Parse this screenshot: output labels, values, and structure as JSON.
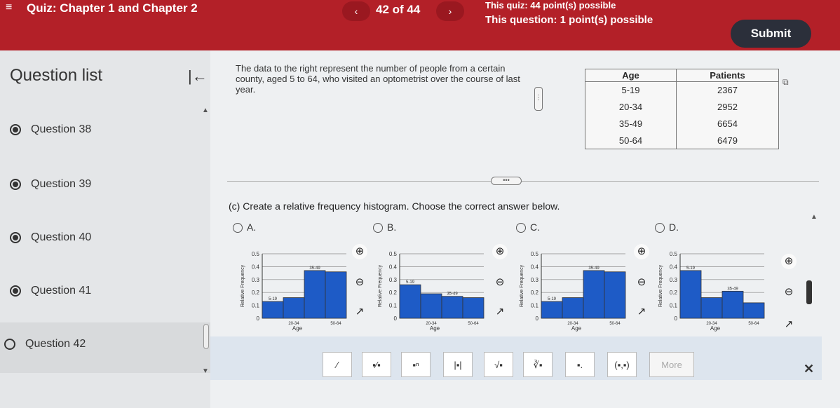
{
  "header": {
    "menu_icon": "≡",
    "quiz_title": "Quiz: Chapter 1 and Chapter 2",
    "prev_icon": "‹",
    "question_counter": "42 of 44",
    "next_icon": "›",
    "quiz_points": "This quiz: 44 point(s) possible",
    "question_points": "This question: 1 point(s) possible",
    "submit_label": "Submit"
  },
  "sidebar": {
    "title": "Question list",
    "collapse_icon": "|←",
    "items": [
      {
        "label": "Question 38"
      },
      {
        "label": "Question 39"
      },
      {
        "label": "Question 40"
      },
      {
        "label": "Question 41"
      },
      {
        "label": "Question 42"
      }
    ]
  },
  "main": {
    "intro": "The data to the right represent the number of people from a certain county, aged 5 to 64, who visited an optometrist over the course of last year.",
    "table": {
      "headers": [
        "Age",
        "Patients"
      ],
      "rows": [
        [
          "5-19",
          "2367"
        ],
        [
          "20-34",
          "2952"
        ],
        [
          "35-49",
          "6654"
        ],
        [
          "50-64",
          "6479"
        ]
      ]
    },
    "prompt": "(c) Create a relative frequency histogram. Choose the correct answer below.",
    "options": [
      {
        "label": "A."
      },
      {
        "label": "B."
      },
      {
        "label": "C."
      },
      {
        "label": "D."
      }
    ]
  },
  "chart_data": [
    {
      "type": "bar",
      "option": "A",
      "categories": [
        "5-19",
        "20-34",
        "35-49",
        "50-64"
      ],
      "values": [
        0.13,
        0.16,
        0.37,
        0.36
      ],
      "ylim": [
        0,
        0.5
      ],
      "yticks": [
        "0",
        "0.1",
        "0.2",
        "0.3",
        "0.4",
        "0.5"
      ],
      "ylabel": "Relative Frequency",
      "xlabel": "Age",
      "bar_labels": [
        "5-19",
        "",
        "35-49",
        ""
      ],
      "xtick_labels": [
        "20-34",
        "50-64"
      ]
    },
    {
      "type": "bar",
      "option": "B",
      "categories": [
        "5-19",
        "20-34",
        "35-49",
        "50-64"
      ],
      "values": [
        0.26,
        0.19,
        0.17,
        0.16
      ],
      "ylim": [
        0,
        0.5
      ],
      "yticks": [
        "0",
        "0.1",
        "0.2",
        "0.3",
        "0.4",
        "0.5"
      ],
      "ylabel": "Relative Frequency",
      "xlabel": "Age",
      "bar_labels": [
        "5-19",
        "",
        "35-49",
        ""
      ],
      "xtick_labels": [
        "20-34",
        "50-64"
      ]
    },
    {
      "type": "bar",
      "option": "C",
      "categories": [
        "5-19",
        "20-34",
        "35-49",
        "50-64"
      ],
      "values": [
        0.13,
        0.16,
        0.37,
        0.36
      ],
      "ylim": [
        0,
        0.5
      ],
      "yticks": [
        "0",
        "0.1",
        "0.2",
        "0.3",
        "0.4",
        "0.5"
      ],
      "ylabel": "Relative Frequency",
      "xlabel": "Age",
      "bar_labels": [
        "5-19",
        "",
        "35-49",
        ""
      ],
      "xtick_labels": [
        "20-34",
        "50-64"
      ]
    },
    {
      "type": "bar",
      "option": "D",
      "categories": [
        "5-19",
        "20-34",
        "35-49",
        "50-64"
      ],
      "values": [
        0.37,
        0.16,
        0.21,
        0.12
      ],
      "ylim": [
        0,
        0.5
      ],
      "yticks": [
        "0",
        "0.1",
        "0.2",
        "0.3",
        "0.4",
        "0.5"
      ],
      "ylabel": "Relative Frequency",
      "xlabel": "Age",
      "bar_labels": [
        "5-19",
        "",
        "35-49",
        ""
      ],
      "xtick_labels": [
        "20-34",
        "50-64"
      ]
    }
  ],
  "toolbar": {
    "tools": [
      "⁄",
      "▪⁄▪",
      "▪ⁿ",
      "|▪|",
      "√▪",
      "∛▪",
      "▪.",
      "(▪,▪)",
      "More"
    ],
    "close_icon": "✕"
  },
  "icons": {
    "zoom_in": "🔍",
    "zoom_out": "🔍",
    "popout": "↗"
  }
}
